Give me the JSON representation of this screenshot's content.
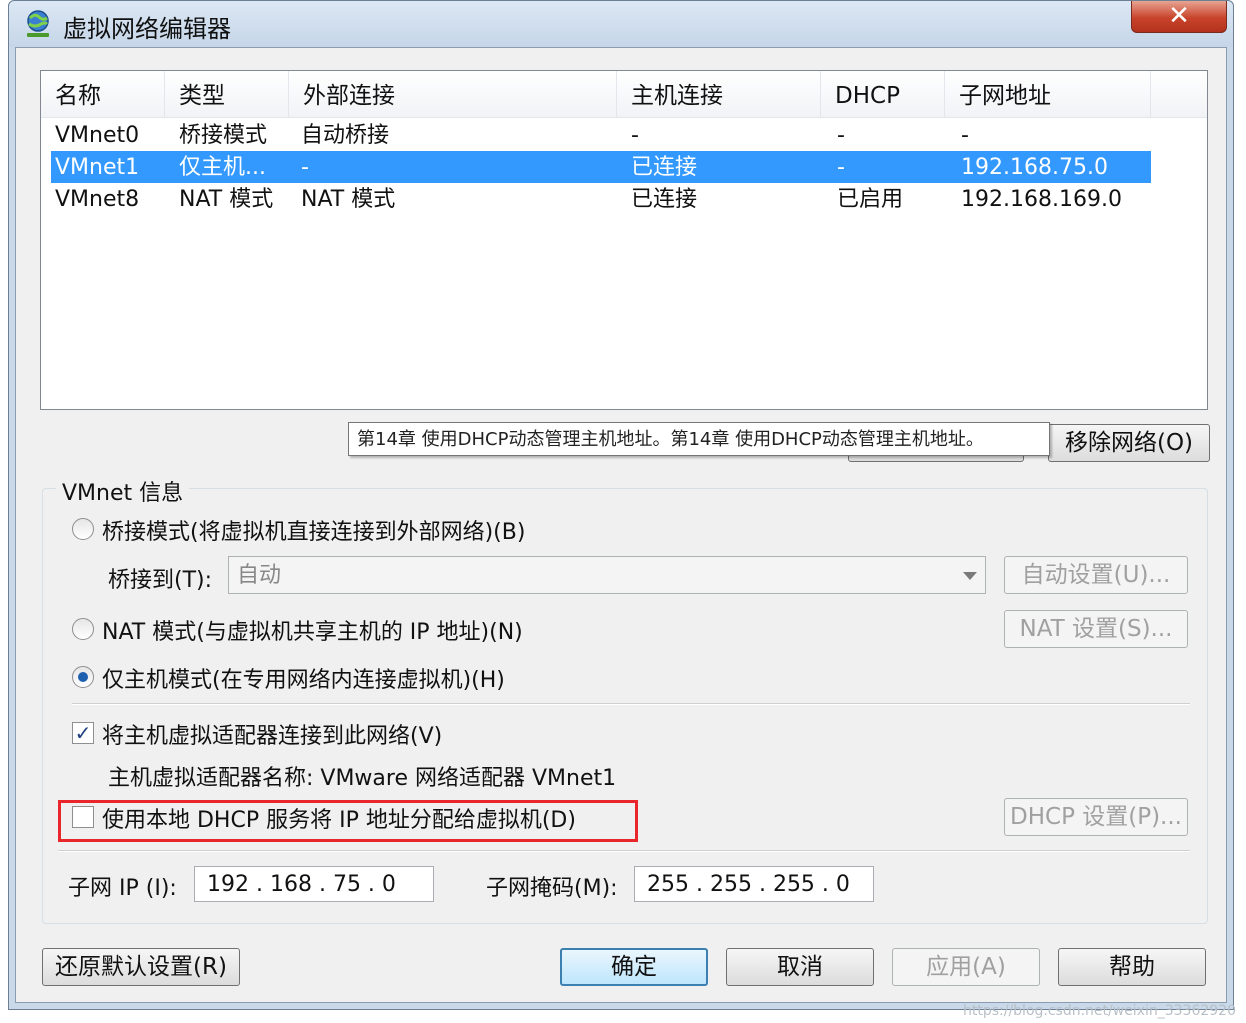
{
  "window": {
    "title": "虚拟网络编辑器",
    "close_glyph": "✕"
  },
  "list": {
    "columns": [
      "名称",
      "类型",
      "外部连接",
      "主机连接",
      "DHCP",
      "子网地址"
    ],
    "rows": [
      [
        "VMnet0",
        "桥接模式",
        "自动桥接",
        "-",
        "-",
        "-"
      ],
      [
        "VMnet1",
        "仅主机...",
        "-",
        "已连接",
        "-",
        "192.168.75.0"
      ],
      [
        "VMnet8",
        "NAT 模式",
        "NAT 模式",
        "已连接",
        "已启用",
        "192.168.169.0"
      ]
    ],
    "selected_row": 1
  },
  "tooltip": "第14章 使用DHCP动态管理主机地址。第14章 使用DHCP动态管理主机地址。",
  "remove_button": "移除网络(O)",
  "vmnet_info": {
    "title": "VMnet 信息",
    "bridge_radio": "桥接模式(将虚拟机直接连接到外部网络)(B)",
    "bridge_to_label": "桥接到(T):",
    "bridge_to_value": "自动",
    "auto_settings_button": "自动设置(U)...",
    "nat_radio": "NAT 模式(与虚拟机共享主机的 IP 地址)(N)",
    "nat_settings_button": "NAT 设置(S)...",
    "host_only_radio": "仅主机模式(在专用网络内连接虚拟机)(H)",
    "selected_mode": "host_only",
    "connect_adapter_checkbox": "将主机虚拟适配器连接到此网络(V)",
    "connect_adapter_checked": true,
    "adapter_name_label": "主机虚拟适配器名称: VMware 网络适配器 VMnet1",
    "dhcp_checkbox": "使用本地 DHCP 服务将 IP 地址分配给虚拟机(D)",
    "dhcp_checked": false,
    "dhcp_settings_button": "DHCP 设置(P)...",
    "subnet_ip_label": "子网 IP (I):",
    "subnet_ip_value": "192 . 168 . 75  .  0",
    "subnet_mask_label": "子网掩码(M):",
    "subnet_mask_value": "255 . 255 . 255 .  0"
  },
  "footer": {
    "restore_button": "还原默认设置(R)",
    "ok_button": "确定",
    "cancel_button": "取消",
    "apply_button": "应用(A)",
    "help_button": "帮助"
  },
  "watermark": "https://blog.csdn.net/weixin_33362920",
  "colors": {
    "selection": "#3399ff",
    "highlight": "#e8262b",
    "default_button": "#3c7fb1"
  }
}
